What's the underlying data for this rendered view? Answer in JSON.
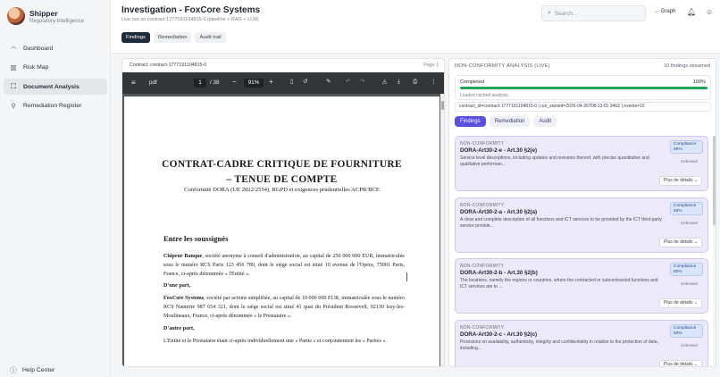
{
  "sidebar": {
    "brand_name": "Shipper",
    "brand_sub": "Regulatory Intelligence",
    "items": [
      {
        "label": "Dashboard",
        "icon": "dashboard-icon"
      },
      {
        "label": "Risk Map",
        "icon": "map-icon"
      },
      {
        "label": "Document Analysis",
        "icon": "document-scan-icon"
      },
      {
        "label": "Remediation Register",
        "icon": "wrench-icon"
      }
    ],
    "help_label": "Help Center"
  },
  "header": {
    "title": "Investigation - FoxCore Systems",
    "subtitle": "Live run on contract-1777191104815-0 (pipeline + RAG + LLM)",
    "tabs": [
      "Findings",
      "Remediation",
      "Audit trail"
    ],
    "search_placeholder": "Search...",
    "graph_label": "Graph"
  },
  "document": {
    "contract_label": "Contract: contract-1777191104815-0",
    "page_label": "Page 1",
    "toolbar": {
      "file": "pdf",
      "page": "1",
      "total": "/ 38",
      "zoom": "91%"
    },
    "heading_line1": "CONTRAT-CADRE CRITIQUE DE FOURNITURE",
    "heading_line2": "– TENUE DE COMPTE",
    "compliance_line": "Conformité DORA (UE 2022/2554), RGPD et exigences prudentielles ACPR/BCE",
    "section_title": "Entre les soussignés",
    "party1_name": "Chipeur Banque",
    "party1_text": ", société anonyme à conseil d'administration, au capital de 250 000 000 EUR, immatriculée sous le numéro RCS Paris 123 456 789, dont le siège social est situé 10 avenue de l'Opéra, 75001 Paris, France, ci-après dénommée « l'Entité ».",
    "part1": "D'une part,",
    "party2_name": "FoxCore Systems",
    "party2_text": ", société par actions simplifiée, au capital de 10 000 000 EUR, immatriculée sous le numéro RCS Nanterre 987 654 321, dont le siège social est situé 41 quai du Président Roosevelt, 92130 Issy-les-Moulineaux, France, ci-après dénommée « le Prestataire ».",
    "part2": "D'autre part,",
    "closing": "L'Entité et le Prestataire étant ci-après individuellement une « Partie » et conjointement les « Parties »."
  },
  "analysis": {
    "title": "NON-CONFORMITY ANALYSIS (LIVE)",
    "count": "10 findings streamed",
    "status": "Completed",
    "percent": "100%",
    "progress": 1.0,
    "note": "Loaded cached analysis.",
    "run_line": "contract_id=contract-1777191104815-0 | run_started=2026-04-26T08:13:01.946Z | events=10",
    "tabs": [
      "Findings",
      "Remediation",
      "Audit"
    ],
    "cards": [
      {
        "tag": "NON-CONFORMITY",
        "code": "DORA-Art30-2-e - Art.30 §2(e)",
        "desc": "Service level descriptions, including updates and revisions thereof, with precise quantitative and qualitative performan...",
        "badge_l1": "Compliance",
        "badge_l2": "50%",
        "status": "Unknown",
        "more": "Plus de détails"
      },
      {
        "tag": "NON-CONFORMITY",
        "code": "DORA-Art30-2-a - Art.30 §2(a)",
        "desc": "A clear and complete description of all functions and ICT services to be provided by the ICT third-party service provide...",
        "badge_l1": "Compliance",
        "badge_l2": "50%",
        "status": "Unknown",
        "more": "Plus de détails"
      },
      {
        "tag": "NON-CONFORMITY",
        "code": "DORA-Art30-2-b - Art.30 §2(b)",
        "desc": "The locations, namely the regions or countries, where the contracted or subcontracted functions and ICT services are to ...",
        "badge_l1": "Compliance",
        "badge_l2": "50%",
        "status": "Unknown",
        "more": "Plus de détails"
      },
      {
        "tag": "NON-CONFORMITY",
        "code": "DORA-Art30-2-c - Art.30 §2(c)",
        "desc": "Provisions on availability, authenticity, integrity and confidentiality in relation to the protection of data, including...",
        "badge_l1": "Compliance",
        "badge_l2": "50%",
        "status": "Unknown",
        "more": "Plus de détails"
      }
    ]
  },
  "colors": {
    "accent": "#5b4fe0",
    "progress": "#23a35a",
    "card_bg": "#ece9fb"
  }
}
